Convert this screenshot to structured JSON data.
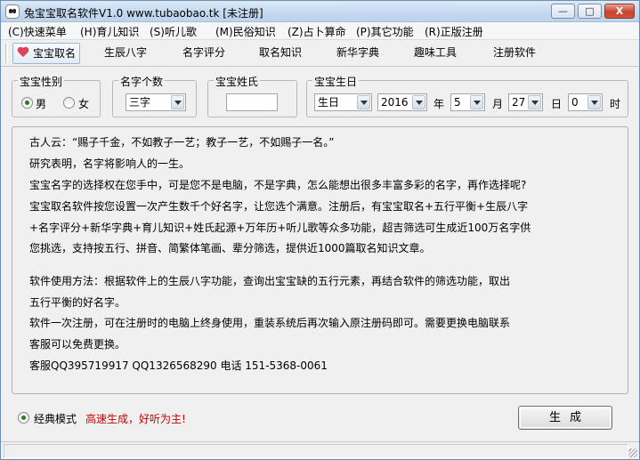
{
  "window": {
    "title": "兔宝宝取名软件V1.0   www.tubaobao.tk  [未注册]",
    "controls": {
      "minimize": "—",
      "maximize": "□",
      "close": "X"
    }
  },
  "menu": [
    "(C)快速菜单",
    "(H)育儿知识",
    "(S)听儿歌",
    "(M)民俗知识",
    "(Z)占卜算命",
    "(P)其它功能",
    "(R)正版注册"
  ],
  "toolbar": [
    "宝宝取名",
    "生辰八字",
    "名字评分",
    "取名知识",
    "新华字典",
    "趣味工具",
    "注册软件"
  ],
  "gender": {
    "legend": "宝宝性别",
    "options": [
      "男",
      "女"
    ],
    "selected": "男"
  },
  "name_count": {
    "legend": "名字个数",
    "selected": "三字"
  },
  "surname": {
    "legend": "宝宝姓氏",
    "value": ""
  },
  "birthday": {
    "legend": "宝宝生日",
    "calendar": "生日",
    "year": "2016",
    "year_label": "年",
    "month": "5",
    "month_label": "月",
    "day": "27",
    "day_label": "日",
    "hour": "0",
    "hour_label": "时"
  },
  "info_lines": [
    "古人云：“赐子千金，不如教子一艺；教子一艺，不如赐子一名。”",
    "研究表明，名字将影响人的一生。",
    "宝宝名字的选择权在您手中，可是您不是电脑，不是字典，怎么能想出很多丰富多彩的名字，再作选择呢?",
    "宝宝取名软件按您设置一次产生数千个好名字，让您选个满意。注册后，有宝宝取名+五行平衡+生辰八字",
    "+名字评分+新华字典+育儿知识+姓氏起源+万年历+听儿歌等众多功能，超吉筛选可生成近100万名字供",
    "您挑选，支持按五行、拼音、简繁体笔画、辈分筛选，提供近1000篇取名知识文章。",
    "软件使用方法：根据软件上的生辰八字功能，查询出宝宝缺的五行元素，再结合软件的筛选功能，取出",
    "五行平衡的好名字。",
    "软件一次注册，可在注册时的电脑上终身使用，重装系统后再次输入原注册码即可。需要更换电脑联系",
    "客服可以免费更换。",
    "客服QQ395719917 QQ1326568290 电话 151-5368-0061"
  ],
  "mode": {
    "label": "经典模式",
    "note": "高速生成，好听为主!"
  },
  "generate_button": "生成"
}
